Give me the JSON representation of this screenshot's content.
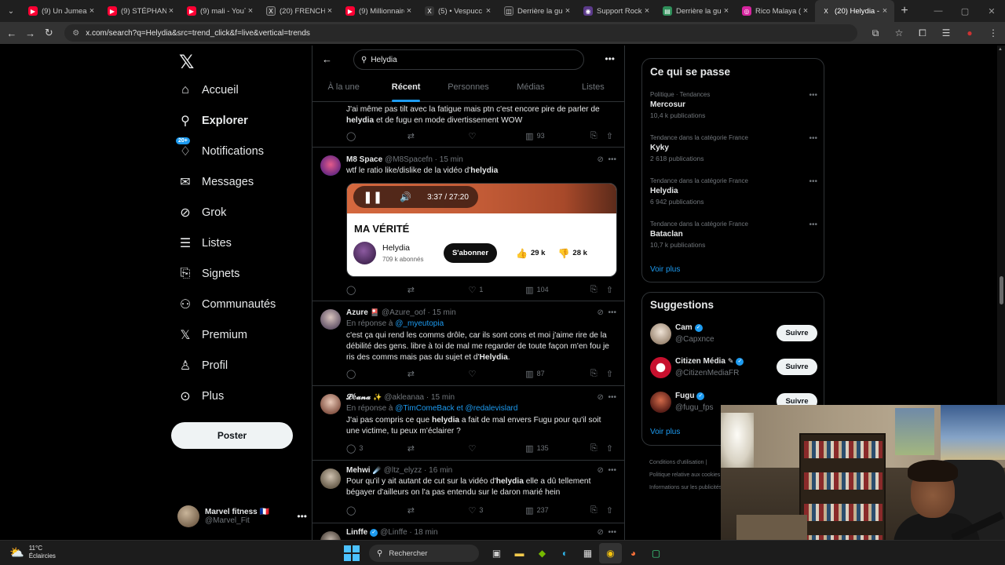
{
  "browser": {
    "tabs": [
      {
        "title": "(9) Un Jumeau",
        "color": "#ff0033",
        "glyph": "▶"
      },
      {
        "title": "(9) STÉPHANE",
        "color": "#ff0033",
        "glyph": "▶"
      },
      {
        "title": "(9) mali - YouTu",
        "color": "#ff0033",
        "glyph": "▶"
      },
      {
        "title": "(20) FRENCHR",
        "color": "#333333",
        "glyph": "X"
      },
      {
        "title": "(9) Millionnaire",
        "color": "#ff0033",
        "glyph": "▶"
      },
      {
        "title": "(5) • Vespucc",
        "color": "#333333",
        "glyph": "X"
      },
      {
        "title": "Derrière la gue",
        "color": "#2b2b2b",
        "glyph": "◫"
      },
      {
        "title": "Support Rocks",
        "color": "#5b3a8a",
        "glyph": "◉"
      },
      {
        "title": "Derrière la gue",
        "color": "#2f8f5a",
        "glyph": "▤"
      },
      {
        "title": "Rico Malaya (@",
        "color": "#d6249f",
        "glyph": "◎"
      },
      {
        "title": "(20) Helydia - X",
        "color": "#333333",
        "glyph": "X"
      }
    ],
    "url": "x.com/search?q=Helydia&src=trend_click&f=live&vertical=trends"
  },
  "nav": {
    "items": [
      {
        "label": "Accueil",
        "icon": "home-icon",
        "glyph": "⌂"
      },
      {
        "label": "Explorer",
        "icon": "search-icon",
        "glyph": "⚲"
      },
      {
        "label": "Notifications",
        "icon": "bell-icon",
        "glyph": "♢",
        "badge": "20+"
      },
      {
        "label": "Messages",
        "icon": "mail-icon",
        "glyph": "✉"
      },
      {
        "label": "Grok",
        "icon": "grok-icon",
        "glyph": "⊘"
      },
      {
        "label": "Listes",
        "icon": "list-icon",
        "glyph": "☰"
      },
      {
        "label": "Signets",
        "icon": "bookmark-icon",
        "glyph": "⎘"
      },
      {
        "label": "Communautés",
        "icon": "community-icon",
        "glyph": "⚇"
      },
      {
        "label": "Premium",
        "icon": "x-premium-icon",
        "glyph": "X"
      },
      {
        "label": "Profil",
        "icon": "profile-icon",
        "glyph": "♙"
      },
      {
        "label": "Plus",
        "icon": "more-circle-icon",
        "glyph": "⋯"
      }
    ],
    "post_label": "Poster",
    "account": {
      "name": "Marvel fitness 🇫🇷",
      "handle": "@Marvel_Fit"
    }
  },
  "search": {
    "query": "Helydia",
    "tabs": [
      "À la une",
      "Récent",
      "Personnes",
      "Médias",
      "Listes"
    ],
    "active_tab": "Récent"
  },
  "tweets": {
    "t0": {
      "text_pre": "J'ai même pas tilt avec la fatigue mais ptn c'est encore pire de parler de ",
      "bold1": "helydia",
      "text_post": " et de fugu en mode divertissement WOW",
      "views": "93"
    },
    "t1": {
      "name": "M8 Space",
      "handle": "@M8Spacefn · 15 min",
      "text_pre": "wtf le ratio like/dislike de la vidéo d'",
      "bold1": "helydia",
      "likes": "1",
      "views": "104",
      "video": {
        "time": "3:37 / 27:20",
        "title": "MA VÉRITÉ",
        "channel": "Helydia",
        "subs": "709 k abonnés",
        "subscribe": "S'abonner",
        "likes": "29 k",
        "dislikes": "28 k"
      }
    },
    "t2": {
      "name": "Azure",
      "emoji": "🎴",
      "handle": "@Azure_oof · 15 min",
      "reply_label": "En réponse à",
      "reply_to": "@_myeutopia",
      "text_pre": "c'est ça qui rend les comms drôle, car ils sont cons et moi j'aime rire de la débilité des gens. libre à toi de mal me regarder de toute façon m'en fou je ris des comms mais pas du sujet et d'",
      "bold1": "Helydia",
      "text_post": ".",
      "views": "87"
    },
    "t3": {
      "name": "𝓛é𝓪𝓷𝓪",
      "emoji": "✨",
      "handle": "@akleanaa · 15 min",
      "reply_label": "En réponse à",
      "reply_to": "@TimComeBack",
      "reply_and": "et",
      "reply_to2": "@redalevislard",
      "text_pre": "J'ai pas compris ce que ",
      "bold1": "helydia",
      "text_post": " a fait de mal envers Fugu pour qu'il soit une victime, tu peux m'éclairer ?",
      "replies": "3",
      "views": "135"
    },
    "t4": {
      "name": "Mehwi",
      "emoji": "☄️",
      "handle": "@ltz_elyzz · 16 min",
      "text_pre": "Pour qu'il y ait autant de cut sur la vidéo d'",
      "bold1": "helydia",
      "text_post": " elle a dû tellement bégayer d'ailleurs on l'a pas entendu sur le daron marié hein",
      "likes": "3",
      "views": "237"
    },
    "t5": {
      "name": "Linffe",
      "handle": "@Linffe · 18 min"
    }
  },
  "trends": {
    "title": "Ce qui se passe",
    "items": [
      {
        "context": "Politique · Tendances",
        "name": "Mercosur",
        "count": "10,4 k publications"
      },
      {
        "context": "Tendance dans la catégorie France",
        "name": "Kyky",
        "count": "2 618 publications"
      },
      {
        "context": "Tendance dans la catégorie France",
        "name": "Helydia",
        "count": "6 942 publications"
      },
      {
        "context": "Tendance dans la catégorie France",
        "name": "Bataclan",
        "count": "10,7 k publications"
      }
    ],
    "see_more": "Voir plus"
  },
  "suggestions": {
    "title": "Suggestions",
    "items": [
      {
        "name": "Cam",
        "handle": "@Capxnce",
        "follow": "Suivre",
        "color": "#d8c7b8"
      },
      {
        "name": "Citizen Média",
        "handle": "@CitizenMediaFR",
        "follow": "Suivre",
        "color": "#c8102e"
      },
      {
        "name": "Fugu",
        "handle": "@fugu_fps",
        "follow": "Suivre",
        "color": "#9a4030"
      }
    ],
    "see_more": "Voir plus",
    "footer": [
      "Conditions d'utilisation |",
      "Politique relative aux cookies",
      "Informations sur les publicités"
    ]
  },
  "taskbar": {
    "temp": "11°C",
    "weather": "Éclaircies",
    "search_placeholder": "Rechercher"
  }
}
